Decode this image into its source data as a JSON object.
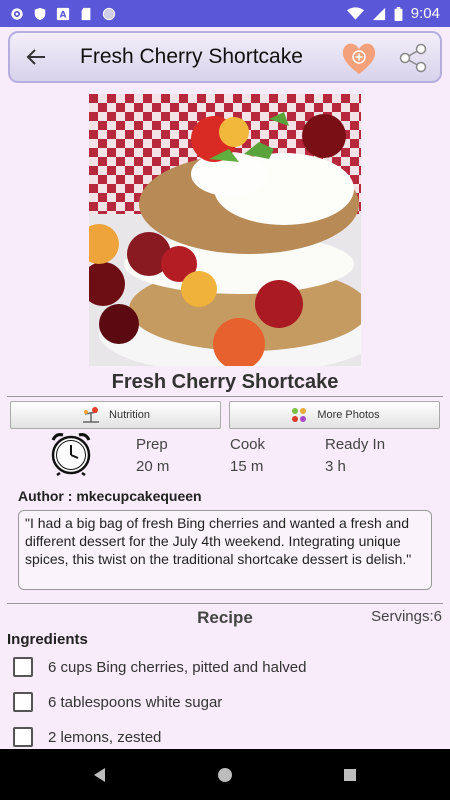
{
  "status_bar": {
    "time": "9:04",
    "left_icons": [
      "gear-icon",
      "shield-icon",
      "text-box-icon",
      "sd-card-icon",
      "circle-icon"
    ],
    "right_icons": [
      "wifi-icon",
      "signal-icon",
      "battery-icon"
    ]
  },
  "app_bar": {
    "title": "Fresh Cherry Shortcake",
    "back_icon": "arrow-left-icon",
    "favorite_icon": "heart-plus-icon",
    "share_icon": "share-icon"
  },
  "recipe": {
    "title": "Fresh Cherry Shortcake",
    "nutrition_label": "Nutrition",
    "photos_label": "More Photos",
    "times": {
      "prep_label": "Prep",
      "prep_value": "20 m",
      "cook_label": "Cook",
      "cook_value": "15 m",
      "ready_label": "Ready In",
      "ready_value": "3 h"
    },
    "author": "Author : mkecupcakequeen",
    "description": "\"I had a big bag of fresh Bing cherries and wanted a fresh and different dessert for the July 4th weekend. Integrating unique spices, this twist on the traditional shortcake dessert is delish.\"",
    "section_title": "Recipe",
    "servings": "Servings:6",
    "ingredients_heading": "Ingredients",
    "ingredients": [
      "6 cups Bing cherries, pitted and halved",
      "6 tablespoons white sugar",
      "2 lemons, zested"
    ]
  },
  "colors": {
    "status_bar": "#5a57d9",
    "background": "#f8ebfa",
    "favorite": "#f4a07a"
  }
}
